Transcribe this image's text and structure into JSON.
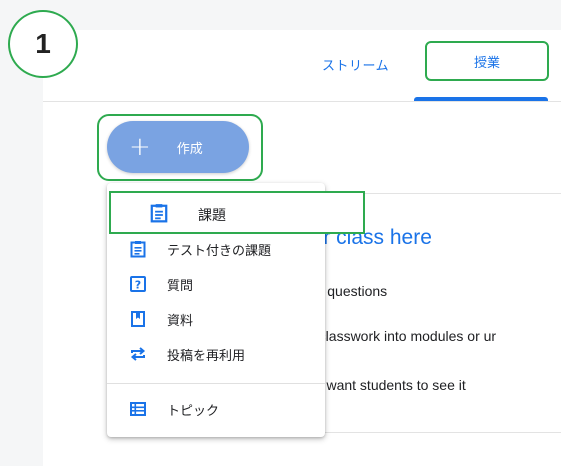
{
  "step_number": "1",
  "tabs": {
    "stream": "ストリーム",
    "classwork": "授業"
  },
  "create_button": {
    "plus": "+",
    "label": "作成"
  },
  "menu": {
    "items": [
      {
        "label": "課題",
        "icon": "assignment-icon"
      },
      {
        "label": "テスト付きの課題",
        "icon": "quiz-assignment-icon"
      },
      {
        "label": "質問",
        "icon": "question-icon"
      },
      {
        "label": "資料",
        "icon": "material-icon"
      },
      {
        "label": "投稿を再利用",
        "icon": "reuse-post-icon"
      },
      {
        "label": "トピック",
        "icon": "topic-icon"
      }
    ]
  },
  "background_card": {
    "title": "our class here",
    "lines": [
      "and questions",
      "ze classwork into modules or ur",
      "you want students to see it"
    ]
  },
  "colors": {
    "accent": "#1a73e8",
    "highlight": "#2eaa4f",
    "create_button": "#7aa3e2"
  }
}
